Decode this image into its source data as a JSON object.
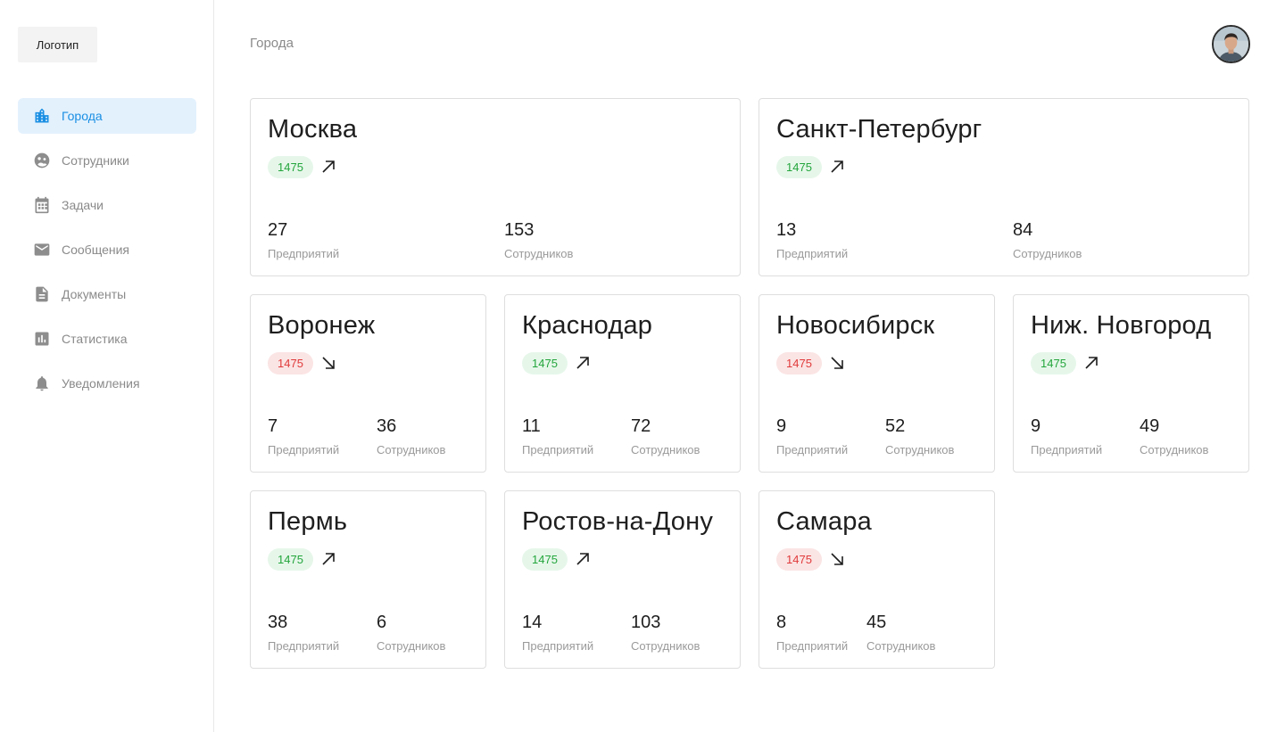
{
  "sidebar": {
    "logo": "Логотип",
    "items": [
      {
        "label": "Города",
        "icon": "city-icon",
        "active": true
      },
      {
        "label": "Сотрудники",
        "icon": "people-icon",
        "active": false
      },
      {
        "label": "Задачи",
        "icon": "calendar-icon",
        "active": false
      },
      {
        "label": "Сообщения",
        "icon": "mail-icon",
        "active": false
      },
      {
        "label": "Документы",
        "icon": "document-icon",
        "active": false
      },
      {
        "label": "Статистика",
        "icon": "chart-icon",
        "active": false
      },
      {
        "label": "Уведомления",
        "icon": "bell-icon",
        "active": false
      }
    ]
  },
  "header": {
    "title": "Города",
    "avatar": "user-avatar"
  },
  "colors": {
    "accent": "#1a8fe3",
    "accent_bg": "#e3f1fd",
    "up_text": "#24a53c",
    "up_bg": "#e6f7ea",
    "down_text": "#e03b3b",
    "down_bg": "#fbe4e4"
  },
  "cards": [
    {
      "city": "Москва",
      "badge": "1475",
      "trend": "up",
      "enterprises": "27",
      "enterprises_label": "Предприятий",
      "employees": "153",
      "employees_label": "Сотрудников"
    },
    {
      "city": "Санкт-Петербург",
      "badge": "1475",
      "trend": "up",
      "enterprises": "13",
      "enterprises_label": "Предприятий",
      "employees": "84",
      "employees_label": "Сотрудников"
    },
    {
      "city": "Воронеж",
      "badge": "1475",
      "trend": "down",
      "enterprises": "7",
      "enterprises_label": "Предприятий",
      "employees": "36",
      "employees_label": "Сотрудников"
    },
    {
      "city": "Краснодар",
      "badge": "1475",
      "trend": "up",
      "enterprises": "11",
      "enterprises_label": "Предприятий",
      "employees": "72",
      "employees_label": "Сотрудников"
    },
    {
      "city": "Новосибирск",
      "badge": "1475",
      "trend": "down",
      "enterprises": "9",
      "enterprises_label": "Предприятий",
      "employees": "52",
      "employees_label": "Сотрудников"
    },
    {
      "city": "Ниж. Новгород",
      "badge": "1475",
      "trend": "up",
      "enterprises": "9",
      "enterprises_label": "Предприятий",
      "employees": "49",
      "employees_label": "Сотрудников"
    },
    {
      "city": "Пермь",
      "badge": "1475",
      "trend": "up",
      "enterprises": "38",
      "enterprises_label": "Предприятий",
      "employees": "6",
      "employees_label": "Сотрудников"
    },
    {
      "city": "Ростов-на-Дону",
      "badge": "1475",
      "trend": "up",
      "enterprises": "14",
      "enterprises_label": "Предприятий",
      "employees": "103",
      "employees_label": "Сотрудников"
    },
    {
      "city": "Самара",
      "badge": "1475",
      "trend": "down",
      "enterprises": "8",
      "enterprises_label": "Предприятий",
      "employees": "45",
      "employees_label": "Сотрудников"
    }
  ]
}
